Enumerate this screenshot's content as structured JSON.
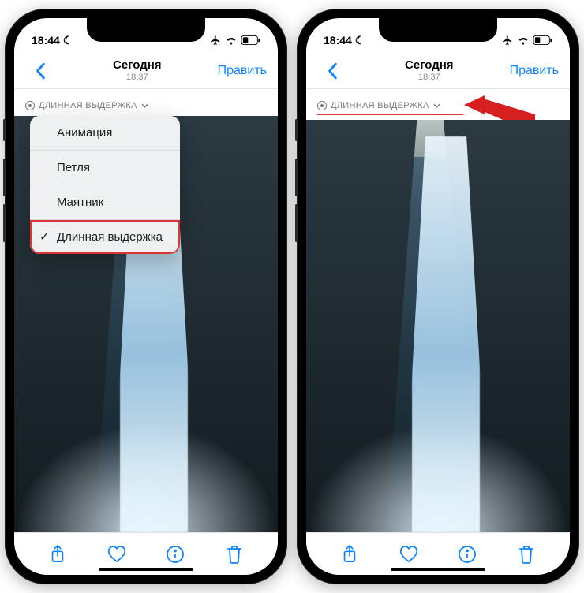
{
  "status": {
    "time": "18:44",
    "moon": "☾"
  },
  "nav": {
    "title": "Сегодня",
    "subtitle": "18:37",
    "edit": "Править"
  },
  "effect": {
    "label": "ДЛИННАЯ ВЫДЕРЖКА"
  },
  "dropdown": {
    "items": [
      {
        "label": "Анимация"
      },
      {
        "label": "Петля"
      },
      {
        "label": "Маятник"
      },
      {
        "label": "Длинная выдержка",
        "selected": true
      }
    ]
  },
  "icons": {
    "share": "share-icon",
    "heart": "heart-icon",
    "info": "info-icon",
    "trash": "trash-icon",
    "back": "chevron-left-icon",
    "chevron_down": "chevron-down-icon",
    "airplane": "airplane-icon",
    "wifi": "wifi-icon",
    "battery": "battery-icon",
    "moon": "moon-icon"
  }
}
